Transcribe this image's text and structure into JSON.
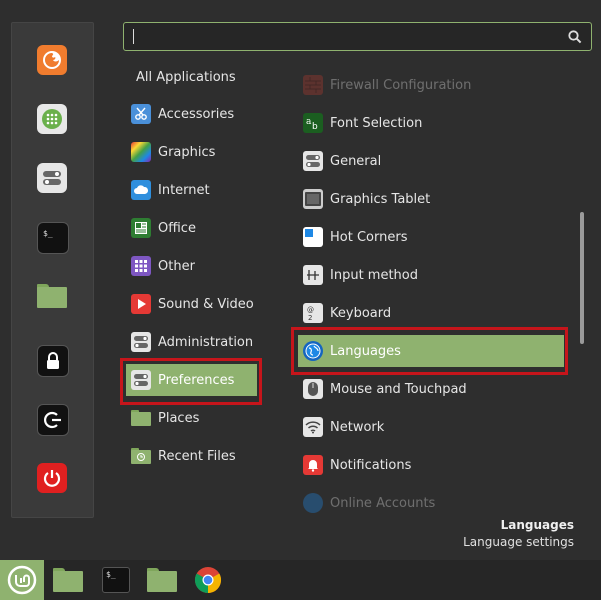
{
  "search": {
    "value": "",
    "placeholder": ""
  },
  "sidebar": {
    "favorites": [
      "firefox-icon",
      "software-manager-icon",
      "settings-icon",
      "terminal-icon",
      "files-icon",
      "lock-icon",
      "logout-icon",
      "shutdown-icon"
    ]
  },
  "categories": {
    "all": "All Applications",
    "items": [
      {
        "label": "Accessories",
        "icon": "scissors-icon"
      },
      {
        "label": "Graphics",
        "icon": "graphics-icon"
      },
      {
        "label": "Internet",
        "icon": "cloud-icon"
      },
      {
        "label": "Office",
        "icon": "office-icon"
      },
      {
        "label": "Other",
        "icon": "grid-icon"
      },
      {
        "label": "Sound & Video",
        "icon": "play-icon"
      },
      {
        "label": "Administration",
        "icon": "toggle-icon"
      },
      {
        "label": "Preferences",
        "icon": "toggle-icon"
      },
      {
        "label": "Places",
        "icon": "folder-icon"
      },
      {
        "label": "Recent Files",
        "icon": "recent-folder-icon"
      }
    ],
    "selected": "Preferences"
  },
  "apps": {
    "items": [
      {
        "label": "Firewall Configuration"
      },
      {
        "label": "Font Selection"
      },
      {
        "label": "General"
      },
      {
        "label": "Graphics Tablet"
      },
      {
        "label": "Hot Corners"
      },
      {
        "label": "Input method"
      },
      {
        "label": "Keyboard"
      },
      {
        "label": "Languages"
      },
      {
        "label": "Mouse and Touchpad"
      },
      {
        "label": "Network"
      },
      {
        "label": "Notifications"
      },
      {
        "label": "Online Accounts"
      }
    ],
    "selected": "Languages"
  },
  "description": {
    "title": "Languages",
    "subtitle": "Language settings"
  },
  "colors": {
    "accent": "#8fb26f",
    "highlight": "#c6151b",
    "background": "#2e2e2e"
  }
}
